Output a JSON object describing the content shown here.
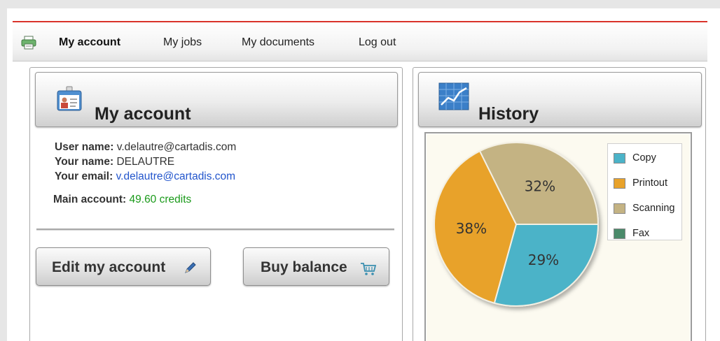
{
  "nav": {
    "items": [
      {
        "label": "My account",
        "active": true
      },
      {
        "label": "My jobs",
        "active": false
      },
      {
        "label": "My documents",
        "active": false
      },
      {
        "label": "Log out",
        "active": false
      }
    ],
    "icon": "printer-icon"
  },
  "account_panel": {
    "title": "My account",
    "icon": "id-card-icon",
    "user_name_label": "User name:",
    "user_name_value": "v.delautre@cartadis.com",
    "your_name_label": "Your name:",
    "your_name_value": "DELAUTRE",
    "email_label": "Your email:",
    "email_value": "v.delautre@cartadis.com",
    "main_account_label": "Main account:",
    "main_account_value": "49.60",
    "main_account_unit": "credits",
    "edit_button": "Edit my account",
    "edit_icon": "pencil-icon",
    "buy_button": "Buy balance",
    "buy_icon": "cart-icon"
  },
  "history_panel": {
    "title": "History",
    "icon": "line-chart-icon"
  },
  "chart_data": {
    "type": "pie",
    "title": "",
    "categories": [
      "Copy",
      "Printout",
      "Scanning",
      "Fax"
    ],
    "values": [
      29,
      38,
      32,
      0
    ],
    "slice_labels": [
      "29%",
      "38%",
      "32%",
      ""
    ],
    "colors": [
      "#4bb3c8",
      "#e8a22a",
      "#c4b383",
      "#4a8a6a"
    ],
    "legend": "top-right"
  }
}
